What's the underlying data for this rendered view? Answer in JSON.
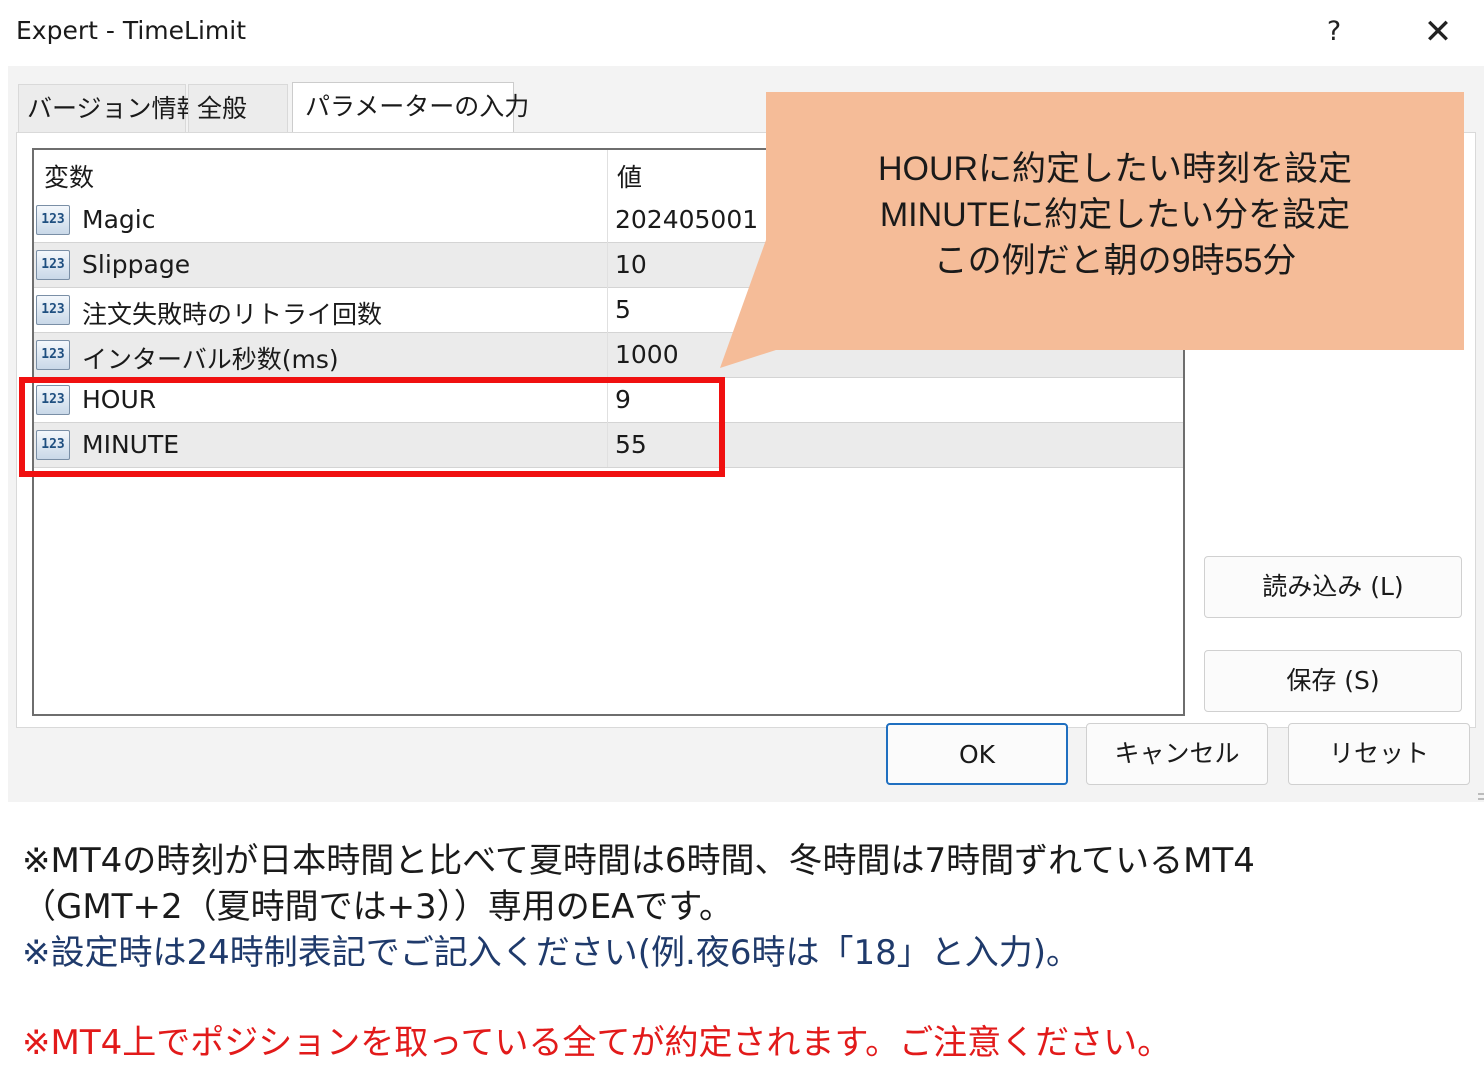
{
  "window": {
    "title": "Expert - TimeLimit",
    "help_label": "?",
    "close_label": "✕"
  },
  "tabs": [
    {
      "label": "バージョン情報"
    },
    {
      "label": "全般"
    },
    {
      "label": "パラメーターの入力",
      "active": true
    }
  ],
  "grid": {
    "headers": {
      "name": "変数",
      "value": "値"
    },
    "rows": [
      {
        "icon": "123",
        "name": "Magic",
        "value": "202405001"
      },
      {
        "icon": "123",
        "name": "Slippage",
        "value": "10"
      },
      {
        "icon": "123",
        "name": "注文失敗時のリトライ回数",
        "value": "5"
      },
      {
        "icon": "123",
        "name": "インターバル秒数(ms)",
        "value": "1000"
      },
      {
        "icon": "123",
        "name": "HOUR",
        "value": "9"
      },
      {
        "icon": "123",
        "name": "MINUTE",
        "value": "55"
      }
    ]
  },
  "side_buttons": {
    "load": "読み込み (L)",
    "save": "保存 (S)"
  },
  "bottom_buttons": {
    "ok": "OK",
    "cancel": "キャンセル",
    "reset": "リセット"
  },
  "callout": {
    "lines": [
      "HOURに約定したい時刻を設定",
      "MINUTEに約定したい分を設定",
      "この例だと朝の9時55分"
    ],
    "color": "#f5bc98"
  },
  "notes": {
    "line1": "※MT4の時刻が日本時間と比べて夏時間は6時間、冬時間は7時間ずれているMT4",
    "line2": "（GMT+2（夏時間では+3））専用のEAです。",
    "line3": "※設定時は24時制表記でご記入ください(例.夜6時は「18」と入力)。",
    "warning": "※MT4上でポジションを取っている全てが約定されます。ご注意ください。"
  },
  "colors": {
    "highlight": "#f01010",
    "warning_text": "#e21a1a",
    "ok_border": "#1f6fc0"
  }
}
